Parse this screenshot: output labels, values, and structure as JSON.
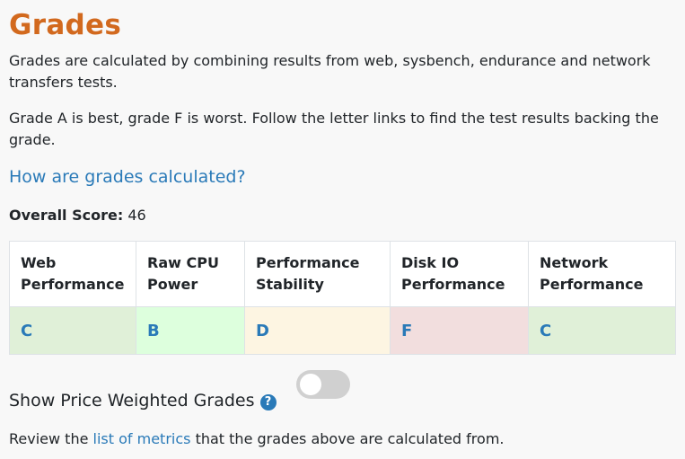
{
  "page": {
    "title": "Grades",
    "intro_1": "Grades are calculated by combining results from web, sysbench, endurance and network transfers tests.",
    "intro_2": "Grade A is best, grade F is worst. Follow the letter links to find the test results backing the grade.",
    "how_link": "How are grades calculated?"
  },
  "overall": {
    "label": "Overall Score:",
    "value": "46"
  },
  "grades": {
    "headers": [
      "Web Performance",
      "Raw CPU Power",
      "Performance Stability",
      "Disk IO Performance",
      "Network Performance"
    ],
    "values": [
      "C",
      "B",
      "D",
      "F",
      "C"
    ],
    "colors": [
      "#e0f0d8",
      "#ddffdd",
      "#fdf5e2",
      "#f2dede",
      "#e0f0d8"
    ]
  },
  "toggle": {
    "label": "Show Price Weighted Grades",
    "help_icon": "question-circle-icon",
    "help_glyph": "?",
    "checked": false
  },
  "review": {
    "prefix": "Review the",
    "link": "list of metrics",
    "suffix": "that the grades above are calculated from."
  }
}
